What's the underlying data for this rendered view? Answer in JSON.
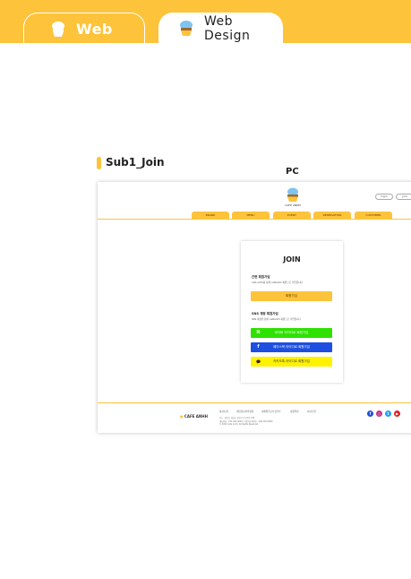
{
  "tabs": [
    {
      "label": "Web",
      "active": false
    },
    {
      "label": "Web Design",
      "active": true
    }
  ],
  "section": {
    "title": "Sub1_Join",
    "device_label": "PC"
  },
  "colors": {
    "accent": "#fdc33a",
    "naver": "#2ee100",
    "facebook": "#1f4fe0",
    "kakao": "#fff200"
  },
  "site": {
    "logo_text": "CAFE ANNH",
    "header_buttons": [
      "login",
      "join"
    ],
    "nav": [
      "BRAND",
      "MENU",
      "EVENT",
      "RESERVATION",
      "CUSTOMER"
    ]
  },
  "join": {
    "title": "JOIN",
    "general_heading": "간편 회원가입",
    "general_desc": "cafe anhh를 통해 cafeanhh 회원으로 가입합니다",
    "signup_button": "회원가입",
    "sns_heading": "SNS 계정 회원가입",
    "sns_desc": "SNS 계정을 통해 cafeanhh 회원으로 가입합니다",
    "naver_button": "네이버 아이디로 회원가입",
    "facebook_button": "페이스북 아이디로 회원가입",
    "kakao_button": "카카오톡 아이디로 회원가입"
  },
  "footer": {
    "logo": "CAFE ANHH",
    "links": [
      "회사소개",
      "개인정보처리방침",
      "이메일무단수집거부",
      "이용약관",
      "사이트맵"
    ],
    "info_lines": [
      "주소 : 경기도 성남시 분당구 판교역로 235",
      "대표전화 : 031-000-0000 | 사업자등록번호 : 000-00-00000",
      "© 2022 Cafe Anhh. All Rights Reserved."
    ],
    "social_icons": [
      "facebook-icon",
      "instagram-icon",
      "twitter-icon",
      "youtube-icon"
    ]
  }
}
